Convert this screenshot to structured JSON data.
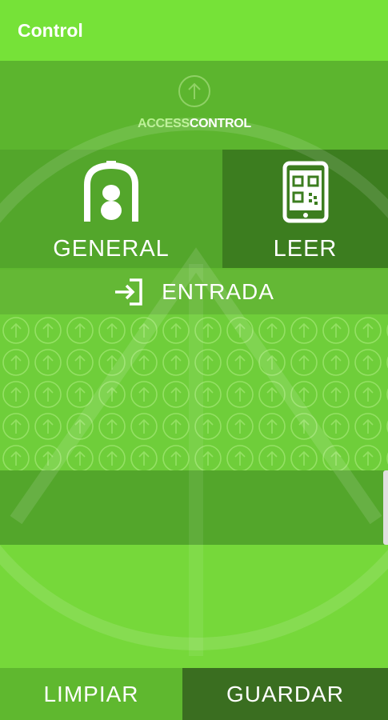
{
  "appbar": {
    "title": "Control"
  },
  "logo": {
    "text_part1": "ACCESS",
    "text_part2": "CONTROL",
    "icon": "arrow-up-circle-icon"
  },
  "tiles": {
    "general": {
      "label": "GENERAL",
      "icon": "arch-detector-icon"
    },
    "leer": {
      "label": "LEER",
      "icon": "qr-tablet-icon"
    }
  },
  "entrada": {
    "label": "ENTRADA",
    "icon": "login-arrow-icon"
  },
  "footer": {
    "limpiar_label": "LIMPIAR",
    "guardar_label": "GUARDAR"
  },
  "colors": {
    "appbar": "#76e238",
    "tile_general": "#53a62b",
    "tile_leer_selected": "#3c7d1f",
    "guardar": "#3a6e20"
  }
}
